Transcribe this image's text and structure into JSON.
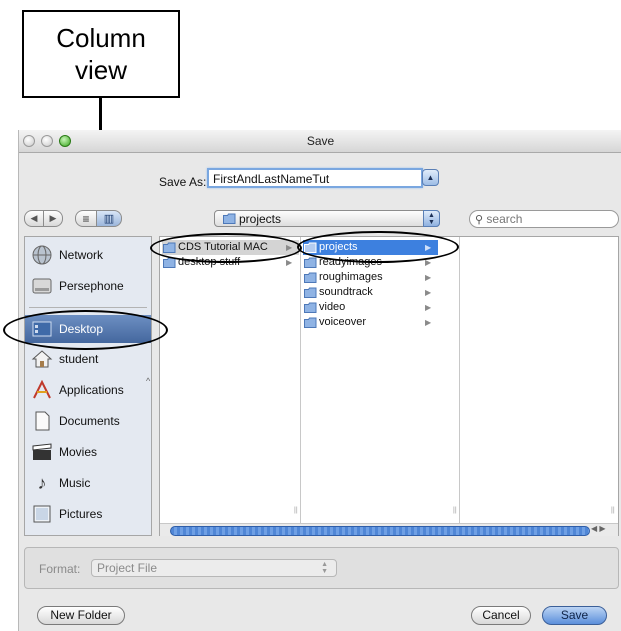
{
  "callout": {
    "line1": "Column",
    "line2": "view"
  },
  "window": {
    "title": "Save",
    "save_as_label": "Save As:",
    "save_as_value": "FirstAndLastNameTut",
    "path_popup": "projects",
    "search_placeholder": "search"
  },
  "sidebar": {
    "items": [
      {
        "label": "Network",
        "icon": "network-icon"
      },
      {
        "label": "Persephone",
        "icon": "hard-drive-icon"
      },
      {
        "label": "Desktop",
        "icon": "desktop-icon",
        "selected": true
      },
      {
        "label": "student",
        "icon": "home-icon"
      },
      {
        "label": "Applications",
        "icon": "applications-icon"
      },
      {
        "label": "Documents",
        "icon": "documents-icon"
      },
      {
        "label": "Movies",
        "icon": "movies-icon"
      },
      {
        "label": "Music",
        "icon": "music-icon"
      },
      {
        "label": "Pictures",
        "icon": "pictures-icon"
      }
    ]
  },
  "browser": {
    "column1": [
      {
        "label": "CDS Tutorial MAC",
        "selected": true
      },
      {
        "label": "desktop stuff"
      }
    ],
    "column2": [
      {
        "label": "projects",
        "selected": true
      },
      {
        "label": "readyimages"
      },
      {
        "label": "roughimages"
      },
      {
        "label": "soundtrack"
      },
      {
        "label": "video"
      },
      {
        "label": "voiceover"
      }
    ]
  },
  "format": {
    "label": "Format:",
    "value": "Project File"
  },
  "buttons": {
    "new_folder": "New Folder",
    "cancel": "Cancel",
    "save": "Save"
  },
  "colors": {
    "selection_blue": "#3d80df",
    "sidebar_selected": "#5577ad",
    "sidebar_bg": "#e4e9f1"
  }
}
